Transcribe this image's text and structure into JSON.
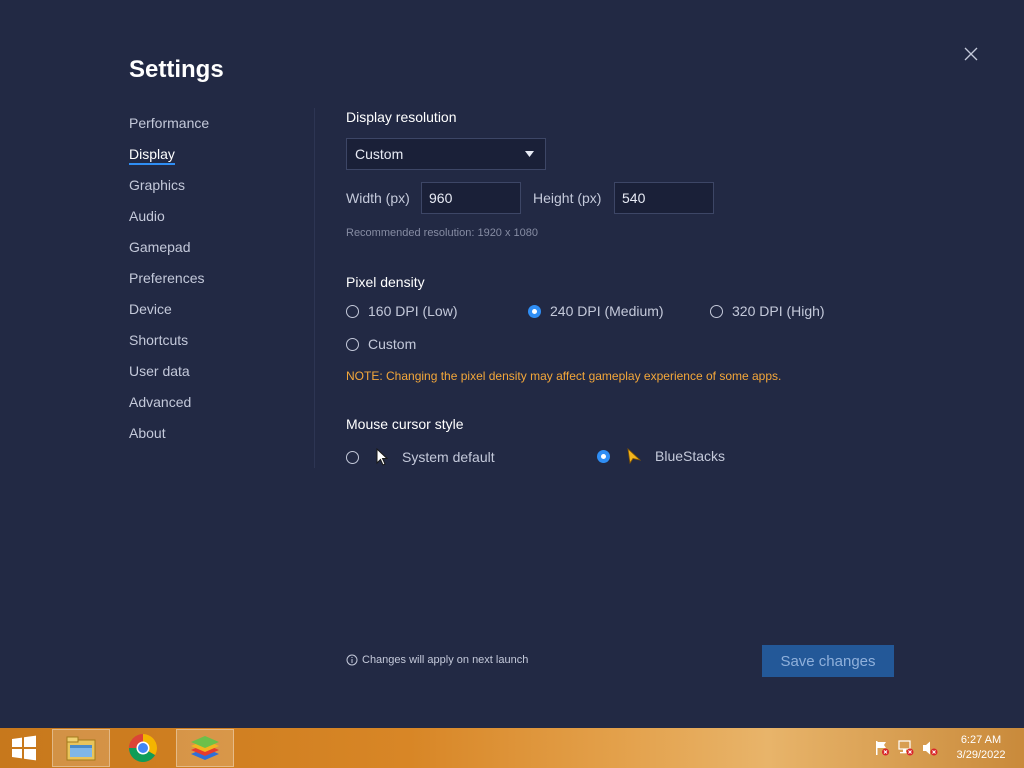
{
  "window": {
    "title": "Settings"
  },
  "sidebar": {
    "items": [
      {
        "label": "Performance"
      },
      {
        "label": "Display"
      },
      {
        "label": "Graphics"
      },
      {
        "label": "Audio"
      },
      {
        "label": "Gamepad"
      },
      {
        "label": "Preferences"
      },
      {
        "label": "Device"
      },
      {
        "label": "Shortcuts"
      },
      {
        "label": "User data"
      },
      {
        "label": "Advanced"
      },
      {
        "label": "About"
      }
    ],
    "active_item": "Display"
  },
  "display_resolution": {
    "title": "Display resolution",
    "selected": "Custom",
    "width_label": "Width (px)",
    "width_value": "960",
    "height_label": "Height (px)",
    "height_value": "540",
    "recommended": "Recommended resolution: 1920 x 1080"
  },
  "pixel_density": {
    "title": "Pixel density",
    "options": [
      {
        "label": "160 DPI (Low)",
        "checked": false
      },
      {
        "label": "240 DPI (Medium)",
        "checked": true
      },
      {
        "label": "320 DPI (High)",
        "checked": false
      },
      {
        "label": "Custom",
        "checked": false
      }
    ],
    "note": "NOTE: Changing the pixel density may affect gameplay experience of some apps."
  },
  "mouse_cursor": {
    "title": "Mouse cursor style",
    "options": [
      {
        "label": "System default",
        "checked": false,
        "icon": "arrow-cursor-icon"
      },
      {
        "label": "BlueStacks",
        "checked": true,
        "icon": "bluestacks-cursor-icon"
      }
    ]
  },
  "footer": {
    "note": "Changes will apply on next launch",
    "save_label": "Save changes"
  },
  "taskbar": {
    "apps": [
      "file-explorer-icon",
      "chrome-icon",
      "bluestacks-icon"
    ],
    "time": "6:27 AM",
    "date": "3/29/2022"
  },
  "colors": {
    "background": "#222944",
    "accent": "#2f8ef5",
    "note": "#f4a73a",
    "save_button": "#235898"
  }
}
